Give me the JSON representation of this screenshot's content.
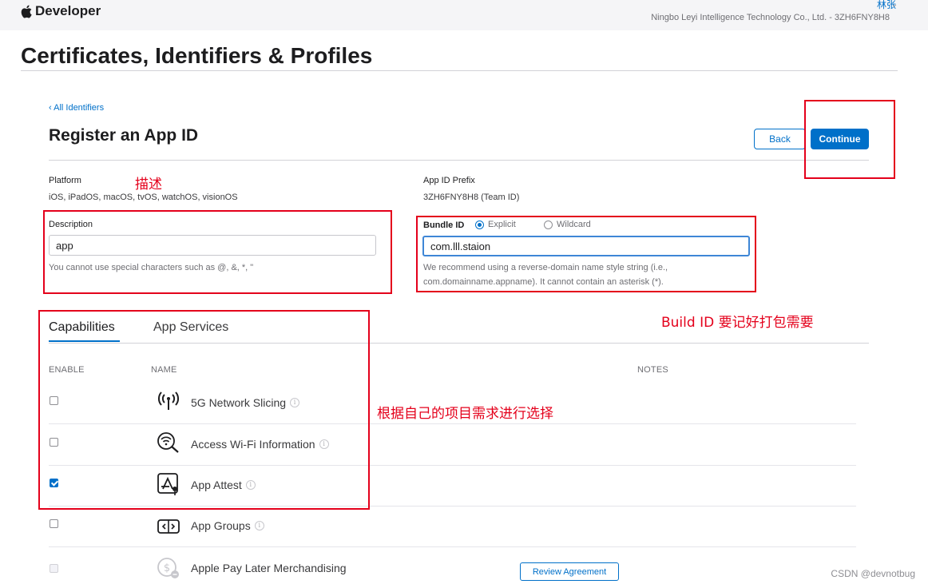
{
  "header": {
    "brand": "Developer",
    "user_name": "林张",
    "team": "Ningbo Leyi Intelligence Technology Co., Ltd. - 3ZH6FNY8H8"
  },
  "page_title": "Certificates, Identifiers & Profiles",
  "breadcrumb": "‹ All Identifiers",
  "register_title": "Register an App ID",
  "buttons": {
    "back": "Back",
    "continue": "Continue",
    "review": "Review Agreement"
  },
  "platform": {
    "label": "Platform",
    "value": "iOS, iPadOS, macOS, tvOS, watchOS, visionOS"
  },
  "prefix": {
    "label": "App ID Prefix",
    "value": "3ZH6FNY8H8 (Team ID)"
  },
  "description": {
    "label": "Description",
    "value": "app",
    "help": "You cannot use special characters such as @, &, *, \""
  },
  "bundle": {
    "label": "Bundle ID",
    "explicit": "Explicit",
    "wildcard": "Wildcard",
    "explicit_selected": true,
    "value": "com.lll.staion",
    "help_line1": "We recommend using a reverse-domain name style string (i.e.,",
    "help_line2": "com.domainname.appname). It cannot contain an asterisk (*)."
  },
  "tabs": [
    {
      "label": "Capabilities",
      "active": true
    },
    {
      "label": "App Services",
      "active": false
    }
  ],
  "columns": {
    "enable": "ENABLE",
    "name": "NAME",
    "notes": "NOTES"
  },
  "capabilities": [
    {
      "name": "5G Network Slicing",
      "icon": "antenna-icon",
      "checked": false
    },
    {
      "name": "Access Wi-Fi Information",
      "icon": "wifi-search-icon",
      "checked": false
    },
    {
      "name": "App Attest",
      "icon": "app-attest-icon",
      "checked": true
    },
    {
      "name": "App Groups",
      "icon": "app-groups-icon",
      "checked": false
    },
    {
      "name": "Apple Pay Later Merchandising",
      "icon": "pay-later-icon",
      "checked": false,
      "disabled": true
    }
  ],
  "annotations": {
    "description_note": "描述",
    "bundle_note": "Build ID 要记好打包需要",
    "capabilities_note": "根据自己的项目需求进行选择"
  },
  "watermark": "CSDN @devnotbug",
  "colors": {
    "accent": "#0070c9",
    "annotation": "#e4001b"
  }
}
